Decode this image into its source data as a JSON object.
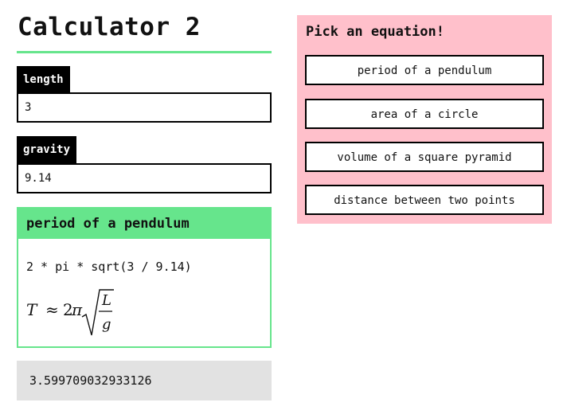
{
  "app": {
    "title": "Calculator 2"
  },
  "inputs": [
    {
      "label": "length",
      "value": "3"
    },
    {
      "label": "gravity",
      "value": "9.14"
    }
  ],
  "equation_card": {
    "title": "period of a pendulum",
    "expression": "2 * pi * sqrt(3 / 9.14)",
    "formula": {
      "lhs": "T",
      "relation": "≈",
      "coefficient": "2",
      "pi": "π",
      "numerator": "L",
      "denominator": "g"
    }
  },
  "result": {
    "value": "3.599709032933126"
  },
  "picker": {
    "title": "Pick an equation!",
    "options": [
      "period of a pendulum",
      "area of a circle",
      "volume of a square pyramid",
      "distance between two points"
    ]
  },
  "colors": {
    "accent_green": "#66e58c",
    "picker_pink": "#ffc0cb",
    "result_gray": "#e2e2e2"
  }
}
